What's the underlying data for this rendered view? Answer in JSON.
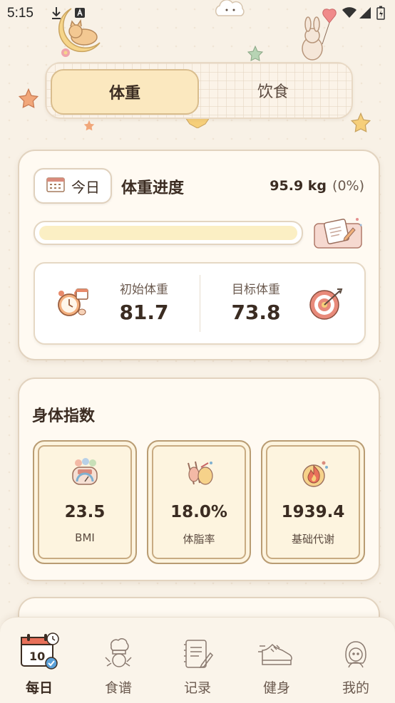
{
  "status_bar": {
    "time": "5:15"
  },
  "tabs": [
    {
      "label": "体重",
      "active": true
    },
    {
      "label": "饮食",
      "active": false
    }
  ],
  "progress_card": {
    "today_label": "今日",
    "title": "体重进度",
    "current_weight": "95.9 kg",
    "change_percent": "(0%)",
    "progress_fraction": 0,
    "start_label": "初始体重",
    "start_value": "81.7",
    "target_label": "目标体重",
    "target_value": "73.8"
  },
  "body_card": {
    "title": "身体指数",
    "metrics": [
      {
        "value": "23.5",
        "label": "BMI",
        "icon": "bmi-gauge-icon"
      },
      {
        "value": "18.0%",
        "label": "体脂率",
        "icon": "caliper-icon"
      },
      {
        "value": "1939.4",
        "label": "基础代谢",
        "icon": "metabolism-flame-icon"
      }
    ]
  },
  "bottom_nav": [
    {
      "label": "每日",
      "icon": "calendar-icon",
      "active": true
    },
    {
      "label": "食谱",
      "icon": "chef-icon",
      "active": false
    },
    {
      "label": "记录",
      "icon": "notebook-icon",
      "active": false
    },
    {
      "label": "健身",
      "icon": "sneaker-icon",
      "active": false
    },
    {
      "label": "我的",
      "icon": "profile-girl-icon",
      "active": false
    }
  ],
  "colors": {
    "background": "#f8f1e6",
    "card": "#fffaf2",
    "accent": "#fbe8bf",
    "progress_track": "#fbefc4",
    "text": "#3b2c22"
  }
}
